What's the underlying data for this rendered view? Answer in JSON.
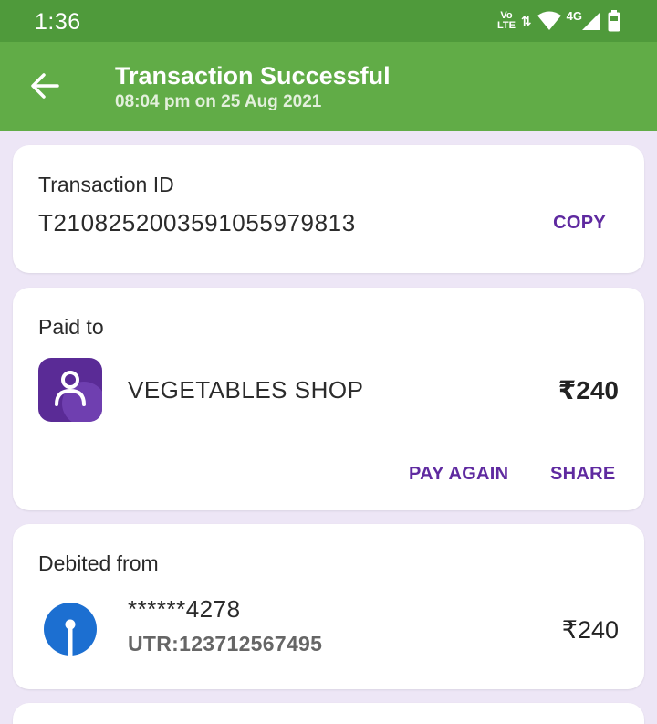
{
  "status_bar": {
    "time": "1:36",
    "volte_line1": "Vo",
    "volte_line2": "LTE",
    "network": "4G",
    "icons": [
      "volte-icon",
      "data-arrows-icon",
      "wifi-icon",
      "signal-icon",
      "battery-icon"
    ]
  },
  "app_bar": {
    "back_icon": "arrow-left-icon",
    "title": "Transaction Successful",
    "subtitle": "08:04 pm on 25 Aug 2021"
  },
  "transaction": {
    "label": "Transaction ID",
    "id": "T2108252003591055979813",
    "copy_label": "COPY"
  },
  "paid_to": {
    "label": "Paid to",
    "name": "VEGETABLES SHOP",
    "amount": "₹240",
    "avatar_icon": "person-icon",
    "pay_again_label": "PAY AGAIN",
    "share_label": "SHARE"
  },
  "debited_from": {
    "label": "Debited from",
    "account": "******4278",
    "utr": "UTR:123712567495",
    "amount": "₹240",
    "bank_icon": "bank-logo-icon"
  },
  "colors": {
    "status_bar": "#4f9a3b",
    "app_bar": "#61ac47",
    "background": "#ede6f6",
    "accent": "#5f2aa0",
    "avatar_bg": "#5a2b96",
    "bank_logo": "#1c6fd1"
  }
}
